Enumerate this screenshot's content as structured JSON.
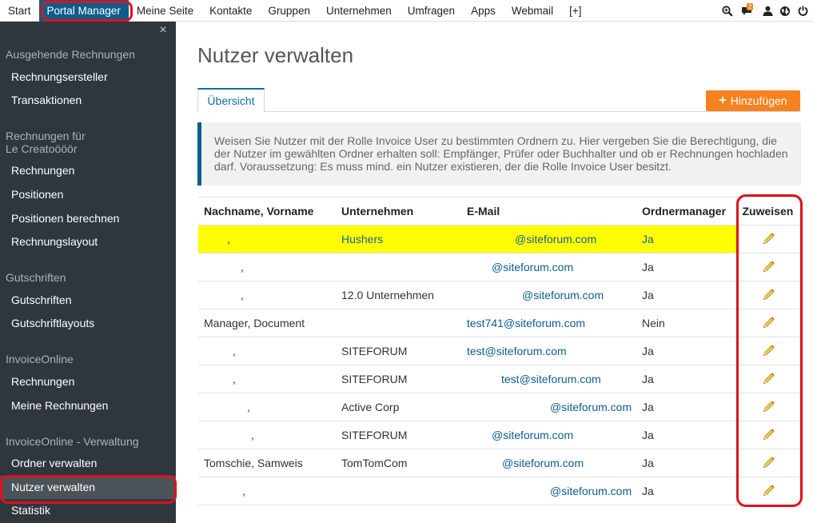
{
  "nav": {
    "items": [
      "Start",
      "Portal Manager",
      "Meine Seite",
      "Kontakte",
      "Gruppen",
      "Unternehmen",
      "Umfragen",
      "Apps",
      "Webmail",
      "[+]"
    ],
    "badge_count": "2"
  },
  "sidebar": {
    "close_label": "×",
    "group1": "Ausgehende Rechnungen",
    "item_rechnungsersteller": "Rechnungsersteller",
    "item_transaktionen": "Transaktionen",
    "group2_line1": "Rechnungen für",
    "group2_line2": "Le Creatoööör",
    "item_rechnungen": "Rechnungen",
    "item_positionen": "Positionen",
    "item_positionen_berechnen": "Positionen berechnen",
    "item_rechnungslayout": "Rechnungslayout",
    "group3": "Gutschriften",
    "item_gutschriften": "Gutschriften",
    "item_gutschriftlayouts": "Gutschriftlayouts",
    "group4": "InvoiceOnline",
    "item_io_rechnungen": "Rechnungen",
    "item_meine_rechnungen": "Meine Rechnungen",
    "group5": "InvoiceOnline - Verwaltung",
    "item_ordner_verwalten": "Ordner verwalten",
    "item_nutzer_verwalten": "Nutzer verwalten",
    "item_statistik": "Statistik"
  },
  "main": {
    "title": "Nutzer verwalten",
    "tab_label": "Übersicht",
    "add_label": "Hinzufügen",
    "info_text": "Weisen Sie Nutzer mit der Rolle Invoice User zu bestimmten Ordnern zu. Hier vergeben Sie die Berechtigung, die der Nutzer im gewählten Ordner erhalten soll: Empfänger, Prüfer oder Buchhalter und ob er Rechnungen hochladen darf. Voraussetzung: Es muss mind. ein Nutzer existieren, der die Rolle Invoice User besitzt."
  },
  "table": {
    "headers": {
      "name": "Nachname, Vorname",
      "company": "Unternehmen",
      "email": "E-Mail",
      "manager": "Ordnermanager",
      "assign": "Zuweisen"
    },
    "rows": [
      {
        "name": ",",
        "company": "Hushers",
        "email": "@siteforum.com",
        "manager": "Ja"
      },
      {
        "name": ",",
        "company": "",
        "email": "@siteforum.com",
        "manager": "Ja"
      },
      {
        "name": ",",
        "company": "12.0 Unternehmen",
        "email": "@siteforum.com",
        "manager": "Ja"
      },
      {
        "name": "Manager, Document",
        "company": "",
        "email": "test741@siteforum.com",
        "manager": "Nein"
      },
      {
        "name": ",",
        "company": "SITEFORUM",
        "email": "test@siteforum.com",
        "manager": "Ja"
      },
      {
        "name": ",",
        "company": "SITEFORUM",
        "email": "test@siteforum.com",
        "manager": "Ja"
      },
      {
        "name": ",",
        "company": "Active Corp",
        "email": "@siteforum.com",
        "manager": "Ja"
      },
      {
        "name": ",",
        "company": "SITEFORUM",
        "email": "@siteforum.com",
        "manager": "Ja"
      },
      {
        "name": "Tomschie, Samweis",
        "company": "TomTomCom",
        "email": "@siteforum.com",
        "manager": "Ja"
      },
      {
        "name": ",",
        "company": "",
        "email": "@siteforum.com",
        "manager": "Ja"
      }
    ]
  },
  "colors": {
    "accent": "#0d5d8a",
    "sidebar_bg": "#2f373e",
    "add_button": "#f5821f",
    "highlight_row": "#ffff00",
    "annotation": "#e0101c"
  },
  "icons": [
    "zoom-icon",
    "chat-icon",
    "user-icon",
    "globe-icon",
    "power-icon",
    "close-icon",
    "plus-icon",
    "pencil-icon"
  ]
}
